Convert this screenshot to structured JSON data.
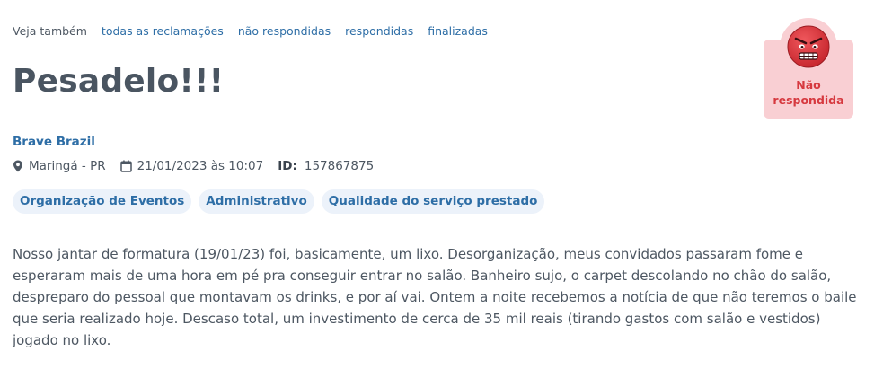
{
  "nav": {
    "lead": "Veja também",
    "links": [
      "todas as reclamações",
      "não respondidas",
      "respondidas",
      "finalizadas"
    ]
  },
  "complaint": {
    "title": "Pesadelo!!!",
    "company": "Brave Brazil",
    "location": "Maringá - PR",
    "datetime": "21/01/2023 às 10:07",
    "id_label": "ID:",
    "id_value": "157867875",
    "tags": [
      "Organização de Eventos",
      "Administrativo",
      "Qualidade do serviço prestado"
    ],
    "text": "Nosso jantar de formatura (19/01/23) foi, basicamente, um lixo. Desorganização, meus convidados passaram fome e esperaram mais de uma hora em pé pra conseguir entrar no salão. Banheiro sujo, o carpet descolando no chão do salão, despreparo do pessoal que montavam os drinks, e por aí vai. Ontem a noite recebemos a notícia de que não teremos o baile que seria realizado hoje. Descaso total, um investimento de cerca de 35 mil reais (tirando gastos com salão e vestidos) jogado no lixo."
  },
  "status": {
    "label": "Não respondida",
    "icon": "angry-face-icon",
    "color": "#d6393f",
    "background": "#f9cfd3"
  },
  "colors": {
    "link": "#2e6ea6",
    "tag_background": "#ecf2fa"
  }
}
